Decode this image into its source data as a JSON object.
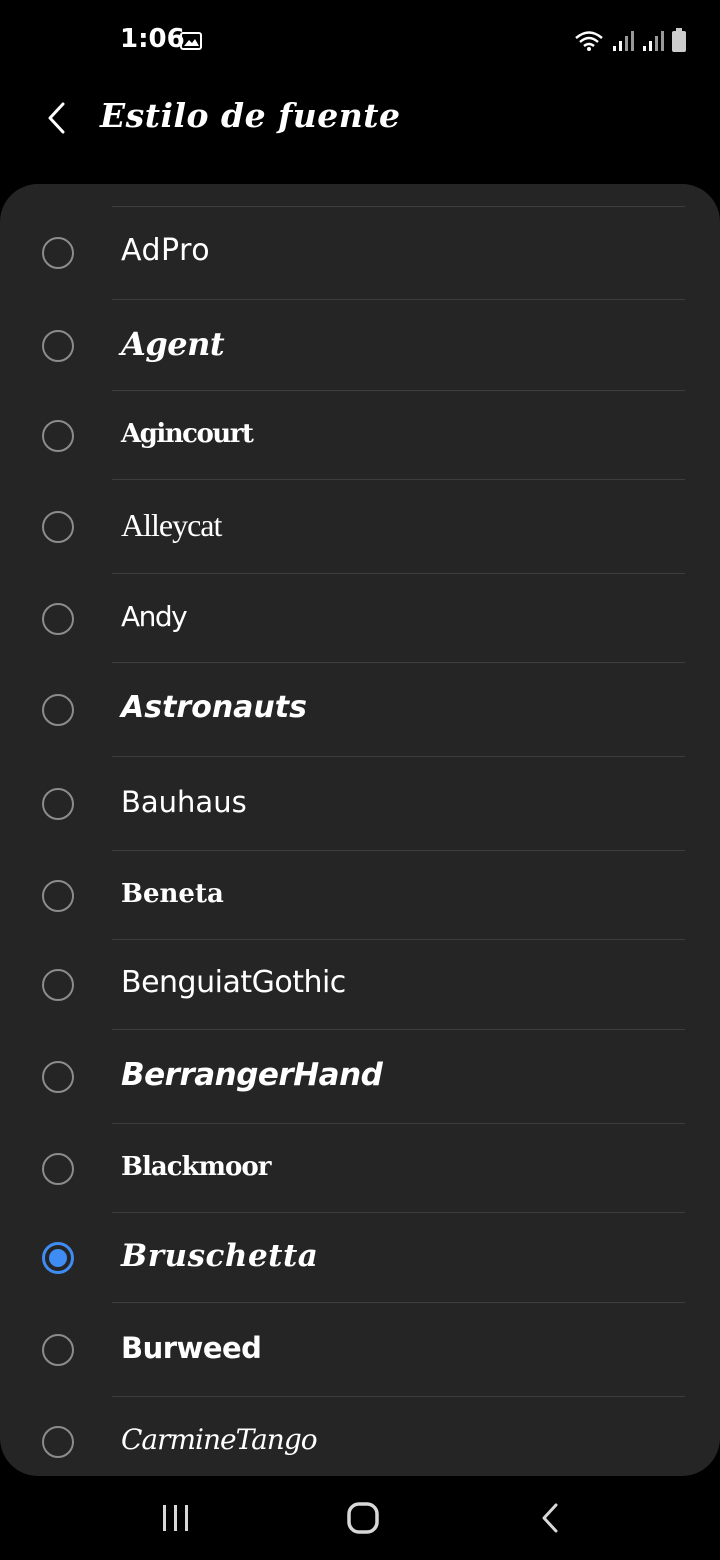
{
  "status_bar": {
    "time": "1:06",
    "icons": [
      "gallery-icon",
      "wifi-icon",
      "signal-icon",
      "signal-icon",
      "battery-icon"
    ]
  },
  "header": {
    "title": "Estilo de fuente",
    "back_icon": "chevron-left-icon"
  },
  "fonts": [
    {
      "name": "AdPro",
      "selected": false
    },
    {
      "name": "Agent",
      "selected": false
    },
    {
      "name": "Agincourt",
      "selected": false
    },
    {
      "name": "Alleycat",
      "selected": false
    },
    {
      "name": "Andy",
      "selected": false
    },
    {
      "name": "Astronauts",
      "selected": false
    },
    {
      "name": "Bauhaus",
      "selected": false
    },
    {
      "name": "Beneta",
      "selected": false
    },
    {
      "name": "BenguiatGothic",
      "selected": false
    },
    {
      "name": "BerrangerHand",
      "selected": false
    },
    {
      "name": "Blackmoor",
      "selected": false
    },
    {
      "name": "Bruschetta",
      "selected": true
    },
    {
      "name": "Burweed",
      "selected": false
    },
    {
      "name": "CarmineTango",
      "selected": false
    }
  ],
  "colors": {
    "accent": "#3e8cf4",
    "card": "#252525",
    "background": "#000000"
  },
  "navigation": {
    "icons": [
      "recent-apps-icon",
      "home-icon",
      "back-icon"
    ]
  }
}
